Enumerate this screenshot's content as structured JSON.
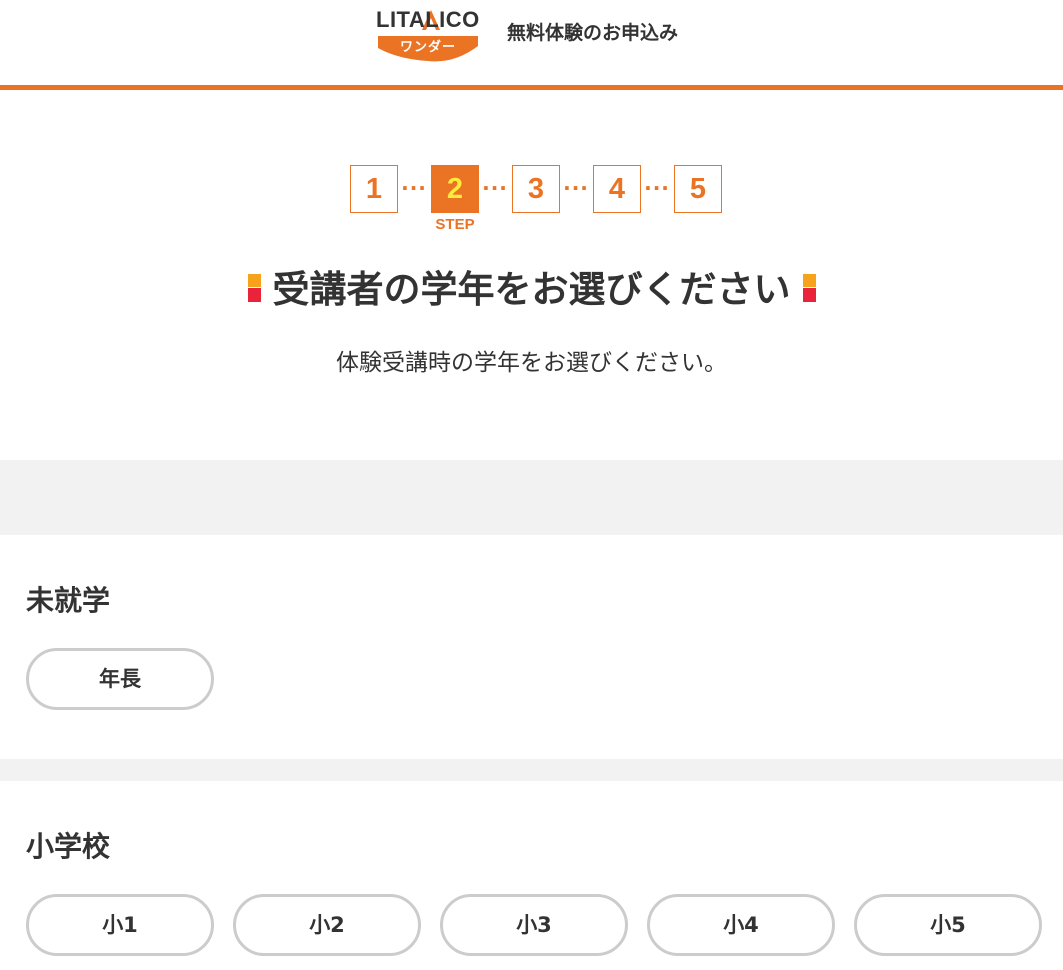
{
  "header": {
    "logo": {
      "brand": "LITALICO",
      "sub": "ワンダー"
    },
    "title": "無料体験のお申込み",
    "accent_color": "#ea7324"
  },
  "steps": {
    "items": [
      "1",
      "2",
      "3",
      "4",
      "5"
    ],
    "current": 2,
    "separator": "···",
    "caption": "STEP"
  },
  "main": {
    "headline": "受講者の学年をお選びください",
    "subtext": "体験受講時の学年をお選びください。",
    "marker_colors": [
      "#f7a21b",
      "#e8233a"
    ]
  },
  "sections": [
    {
      "title": "未就学",
      "options": [
        "年長"
      ]
    },
    {
      "title": "小学校",
      "options": [
        "小1",
        "小2",
        "小3",
        "小4",
        "小5"
      ]
    }
  ]
}
